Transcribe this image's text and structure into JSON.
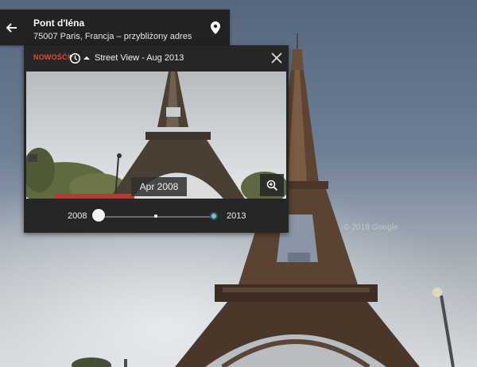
{
  "address": {
    "title": "Pont d'Iéna",
    "subtitle": "75007 Paris, Francja – przybliżony adres",
    "back_icon": "arrow-left-icon",
    "pin_icon": "map-pin-icon"
  },
  "time_machine": {
    "new_label": "NOWOŚĆ!",
    "history_icon": "history-clock-icon",
    "title": "Street View - Aug 2013",
    "close_icon": "close-icon",
    "preview_date": "Apr 2008",
    "zoom_icon": "zoom-in-icon",
    "slider": {
      "start_year": "2008",
      "end_year": "2013",
      "current": "2008"
    }
  },
  "watermark": "© 2019 Google",
  "colors": {
    "new_badge": "#e64a2e",
    "panel_bg": "#262626",
    "card_bg": "#222222",
    "end_dot": "#8bbcd0"
  }
}
